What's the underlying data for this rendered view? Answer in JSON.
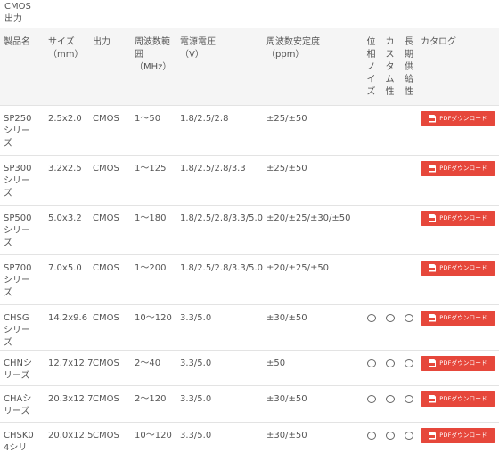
{
  "top_label": [
    "CMOS",
    "出力"
  ],
  "table": {
    "headers": {
      "product": "製品名",
      "size": [
        "サイズ",
        "（mm）"
      ],
      "output": "出力",
      "freq_range": [
        "周波数範",
        "囲",
        "（MHz）"
      ],
      "voltage": [
        "電源電圧",
        "（V）"
      ],
      "stability": [
        "周波数安定度",
        "（ppm）"
      ],
      "phase_noise": "位相ノイズ",
      "custom": "カスタム性",
      "long_supply": "長期供給性",
      "catalog": "カタログ"
    },
    "rows": [
      {
        "name": [
          "SP250",
          "シリーズ"
        ],
        "size": "2.5x2.0",
        "output": "CMOS",
        "freq": "1～50",
        "voltage": "1.8/2.5/2.8",
        "stability": "±25/±50",
        "phase_noise": "",
        "custom": "",
        "long_supply": "",
        "pdf": "PDFダウンロード"
      },
      {
        "name": [
          "SP300",
          "シリーズ"
        ],
        "size": "3.2x2.5",
        "output": "CMOS",
        "freq": "1～125",
        "voltage": "1.8/2.5/2.8/3.3",
        "stability": "±25/±50",
        "phase_noise": "",
        "custom": "",
        "long_supply": "",
        "pdf": "PDFダウンロード"
      },
      {
        "name": [
          "SP500",
          "シリーズ"
        ],
        "size": "5.0x3.2",
        "output": "CMOS",
        "freq": "1～180",
        "voltage": "1.8/2.5/2.8/3.3/5.0",
        "stability": "±20/±25/±30/±50",
        "phase_noise": "",
        "custom": "",
        "long_supply": "",
        "pdf": "PDFダウンロード"
      },
      {
        "name": [
          "SP700",
          "シリーズ"
        ],
        "size": "7.0x5.0",
        "output": "CMOS",
        "freq": "1～200",
        "voltage": "1.8/2.5/2.8/3.3/5.0",
        "stability": "±20/±25/±50",
        "phase_noise": "",
        "custom": "",
        "long_supply": "",
        "pdf": "PDFダウンロード"
      },
      {
        "name": [
          "CHSGシ",
          "リーズ"
        ],
        "size": "14.2x9.6",
        "output": "CMOS",
        "freq": "10～120",
        "voltage": "3.3/5.0",
        "stability": "±30/±50",
        "phase_noise": "○",
        "custom": "○",
        "long_supply": "○",
        "pdf": "PDFダウンロード"
      },
      {
        "name": [
          "CHNシ",
          "リーズ"
        ],
        "size": "12.7x12.7",
        "output": "CMOS",
        "freq": "2～40",
        "voltage": "3.3/5.0",
        "stability": "±50",
        "phase_noise": "○",
        "custom": "○",
        "long_supply": "○",
        "pdf": "PDFダウンロード"
      },
      {
        "name": [
          "CHAシ",
          "リーズ"
        ],
        "size": "20.3x12.7",
        "output": "CMOS",
        "freq": "2～120",
        "voltage": "3.3/5.0",
        "stability": "±30/±50",
        "phase_noise": "○",
        "custom": "○",
        "long_supply": "○",
        "pdf": "PDFダウンロード"
      },
      {
        "name": [
          "CHSK04",
          "シリーズ"
        ],
        "size": "20.0x12.5",
        "output": "CMOS",
        "freq": "10～120",
        "voltage": "3.3/5.0",
        "stability": "±30/±50",
        "phase_noise": "○",
        "custom": "○",
        "long_supply": "○",
        "pdf": "PDFダウンロード"
      }
    ]
  },
  "colors": {
    "button": "#e6473b",
    "header_bg": "#f5f5f5",
    "text": "#555555"
  }
}
